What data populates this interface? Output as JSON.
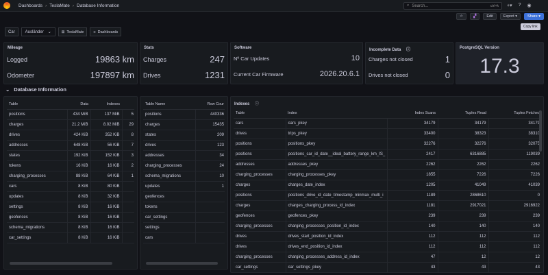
{
  "breadcrumb": [
    "Dashboards",
    "TeslaMate",
    "Database Information"
  ],
  "search": {
    "placeholder": "Search...",
    "shortcut": "ctrl+k"
  },
  "toolbar": {
    "edit": "Edit",
    "export": "Export",
    "share": "Share",
    "share_tooltip": "Copy link"
  },
  "variables": {
    "car_label": "Car",
    "car_value": "Ausländer",
    "link1": "TeslaMate",
    "link2": "Dashboards"
  },
  "mileage": {
    "title": "Mileage",
    "rows": [
      {
        "label": "Logged",
        "value": "19863 km"
      },
      {
        "label": "Odometer",
        "value": "197897 km"
      }
    ]
  },
  "stats": {
    "title": "Stats",
    "rows": [
      {
        "label": "Charges",
        "value": "247"
      },
      {
        "label": "Drives",
        "value": "1231"
      }
    ]
  },
  "software": {
    "title": "Software",
    "rows": [
      {
        "label": "Nº Car Updates",
        "value": "10"
      },
      {
        "label": "Current Car Firmware",
        "value": "2026.20.6.1"
      }
    ]
  },
  "incomplete": {
    "title": "Incomplete Data",
    "rows": [
      {
        "label": "Charges not closed",
        "value": "1"
      },
      {
        "label": "Drives not closed",
        "value": "0"
      }
    ]
  },
  "postgres": {
    "title": "PostgreSQL Version",
    "value": "17.3"
  },
  "row_title": "Database Information",
  "sizes_table": {
    "headers": [
      "Table",
      "Data",
      "Indexes",
      ""
    ],
    "rows": [
      [
        "positions",
        "434 MiB",
        "137 MiB",
        "5"
      ],
      [
        "charges",
        "21.2 MiB",
        "8.02 MiB",
        "29"
      ],
      [
        "drives",
        "424 KiB",
        "352 KiB",
        "8"
      ],
      [
        "addresses",
        "648 KiB",
        "56 KiB",
        "7"
      ],
      [
        "states",
        "192 KiB",
        "152 KiB",
        "3"
      ],
      [
        "tokens",
        "16 KiB",
        "16 KiB",
        "2"
      ],
      [
        "charging_processes",
        "88 KiB",
        "64 KiB",
        "1"
      ],
      [
        "cars",
        "8 KiB",
        "80 KiB",
        ""
      ],
      [
        "updates",
        "8 KiB",
        "32 KiB",
        ""
      ],
      [
        "settings",
        "8 KiB",
        "16 KiB",
        ""
      ],
      [
        "geofences",
        "8 KiB",
        "16 KiB",
        ""
      ],
      [
        "schema_migrations",
        "8 KiB",
        "16 KiB",
        ""
      ],
      [
        "car_settings",
        "8 KiB",
        "16 KiB",
        ""
      ]
    ]
  },
  "rows_table": {
    "headers": [
      "Table Name",
      "Row Cour"
    ],
    "rows": [
      [
        "positions",
        "440336"
      ],
      [
        "charges",
        "15435"
      ],
      [
        "states",
        "209"
      ],
      [
        "drives",
        "123"
      ],
      [
        "addresses",
        "34"
      ],
      [
        "charging_processes",
        "24"
      ],
      [
        "schema_migrations",
        "10"
      ],
      [
        "updates",
        "1"
      ],
      [
        "geofences",
        ""
      ],
      [
        "tokens",
        ""
      ],
      [
        "car_settings",
        ""
      ],
      [
        "settings",
        ""
      ],
      [
        "cars",
        ""
      ]
    ]
  },
  "indexes": {
    "title": "Indexes",
    "headers": [
      "Table",
      "Index",
      "Index Scans",
      "Tuples Read",
      "Tuples Fetched"
    ],
    "rows": [
      [
        "cars",
        "cars_pkey",
        "34179",
        "34179",
        "34179"
      ],
      [
        "drives",
        "trips_pkey",
        "33400",
        "38323",
        "38310"
      ],
      [
        "positions",
        "positions_pkey",
        "32276",
        "32276",
        "32075"
      ],
      [
        "positions",
        "positions_car_id_date__ideal_battery_range_km_IS_",
        "2417",
        "6316885",
        "119039"
      ],
      [
        "addresses",
        "addresses_pkey",
        "2262",
        "2262",
        "2262"
      ],
      [
        "charging_processes",
        "charging_processes_pkey",
        "1855",
        "7226",
        "7226"
      ],
      [
        "charges",
        "charges_date_index",
        "1205",
        "41049",
        "41039"
      ],
      [
        "positions",
        "positions_drive_id_date_timestamp_minmax_multi_i",
        "1189",
        "2868610",
        "0"
      ],
      [
        "charges",
        "charges_charging_process_id_index",
        "1181",
        "2917021",
        "2916922"
      ],
      [
        "geofences",
        "geofences_pkey",
        "239",
        "239",
        "239"
      ],
      [
        "charging_processes",
        "charging_processes_position_id_index",
        "140",
        "140",
        "140"
      ],
      [
        "drives",
        "drives_start_position_id_index",
        "112",
        "112",
        "112"
      ],
      [
        "drives",
        "drives_end_position_id_index",
        "112",
        "112",
        "112"
      ],
      [
        "charging_processes",
        "charging_processes_address_id_index",
        "47",
        "12",
        "12"
      ],
      [
        "car_settings",
        "car_settings_pkey",
        "43",
        "43",
        "43"
      ]
    ]
  }
}
